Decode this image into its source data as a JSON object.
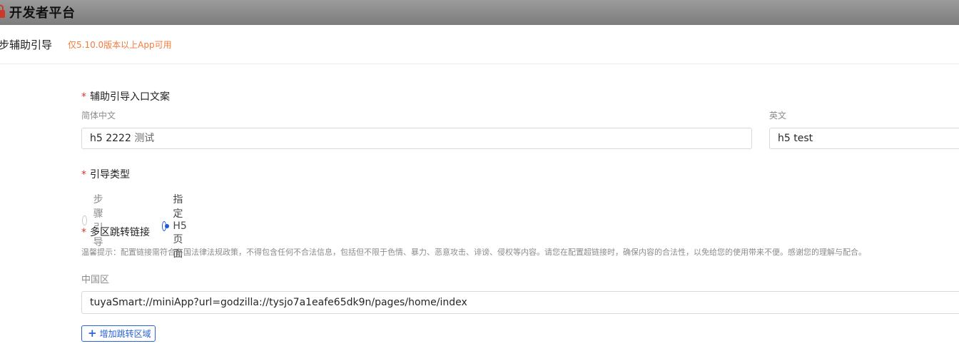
{
  "topbar": {
    "title": "开发者平台",
    "logo": "lock-logo-icon"
  },
  "header": {
    "title": "步辅助引导",
    "note": "仅5.10.0版本以上App可用"
  },
  "entry": {
    "label": "辅助引导入口文案",
    "zh_label": "简体中文",
    "zh_value_a": "h5 2222",
    "zh_value_b": "测试",
    "en_label": "英文",
    "en_value": "h5 test"
  },
  "guide_type": {
    "label": "引导类型",
    "options": [
      {
        "label": "步骤引导",
        "checked": false
      },
      {
        "label": "指定H5页面",
        "checked": true
      }
    ]
  },
  "links": {
    "label": "多区跳转链接",
    "hint": "温馨提示：配置链接需符合各国法律法规政策，不得包含任何不合法信息，包括但不限于色情、暴力、恶意攻击、诽谤、侵权等内容。请您在配置超链接时，确保内容的合法性，以免给您的使用带来不便。感谢您的理解与配合。",
    "region_label": "中国区",
    "region_value": "tuyaSmart://miniApp?url=godzilla://tysjo7a1eafe65dk9n/pages/home/index",
    "add_button": "增加跳转区域"
  },
  "colors": {
    "accent": "#1f5bd9",
    "required": "#e0322f",
    "note": "#f07c3c"
  }
}
